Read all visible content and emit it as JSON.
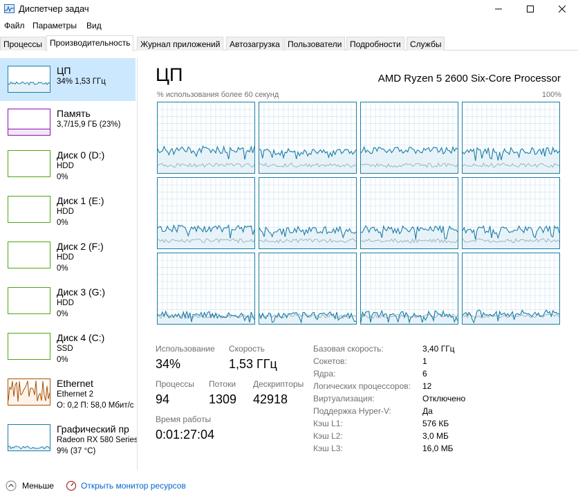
{
  "window": {
    "title": "Диспетчер задач"
  },
  "menu": [
    "Файл",
    "Параметры",
    "Вид"
  ],
  "tabs": [
    "Процессы",
    "Производительность",
    "Журнал приложений",
    "Автозагрузка",
    "Пользователи",
    "Подробности",
    "Службы"
  ],
  "active_tab": 1,
  "sidebar": [
    {
      "name": "ЦП",
      "line2": "34% 1,53 ГГц",
      "line3": "",
      "color": "#1a7ca6",
      "fill": "#e4f1f8",
      "selected": true
    },
    {
      "name": "Память",
      "line2": "3,7/15,9 ГБ (23%)",
      "line3": "",
      "color": "#8b12ae",
      "fill": "#f3e6f7",
      "selected": false
    },
    {
      "name": "Диск 0 (D:)",
      "line2": "HDD",
      "line3": "0%",
      "color": "#4da60c",
      "fill": "#eef7e6",
      "selected": false
    },
    {
      "name": "Диск 1 (E:)",
      "line2": "HDD",
      "line3": "0%",
      "color": "#4da60c",
      "fill": "#eef7e6",
      "selected": false
    },
    {
      "name": "Диск 2 (F:)",
      "line2": "HDD",
      "line3": "0%",
      "color": "#4da60c",
      "fill": "#eef7e6",
      "selected": false
    },
    {
      "name": "Диск 3 (G:)",
      "line2": "HDD",
      "line3": "0%",
      "color": "#4da60c",
      "fill": "#eef7e6",
      "selected": false
    },
    {
      "name": "Диск 4 (C:)",
      "line2": "SSD",
      "line3": "0%",
      "color": "#4da60c",
      "fill": "#eef7e6",
      "selected": false
    },
    {
      "name": "Ethernet",
      "line2": "Ethernet 2",
      "line3": "О: 0,2 П: 58,0 Мбит/с",
      "color": "#a74f01",
      "fill": "#fcf3eb",
      "selected": false
    },
    {
      "name": "Графический пр",
      "line2": "Radeon RX 580 Series",
      "line3": "9% (37 °C)",
      "color": "#1a7ca6",
      "fill": "#e4f1f8",
      "selected": false
    }
  ],
  "main": {
    "title": "ЦП",
    "cpu_model": "AMD Ryzen 5 2600 Six-Core Processor",
    "graph_label": "% использования более 60 секунд",
    "graph_max": "100%",
    "core_count": 12,
    "core_levels": [
      0.33,
      0.3,
      0.32,
      0.31,
      0.28,
      0.26,
      0.27,
      0.27,
      0.13,
      0.12,
      0.14,
      0.15
    ]
  },
  "stats": {
    "usage_label": "Использование",
    "usage_value": "34%",
    "speed_label": "Скорость",
    "speed_value": "1,53 ГГц",
    "processes_label": "Процессы",
    "processes_value": "94",
    "threads_label": "Потоки",
    "threads_value": "1309",
    "handles_label": "Дескрипторы",
    "handles_value": "42918",
    "uptime_label": "Время работы",
    "uptime_value": "0:01:27:04"
  },
  "info": [
    {
      "label": "Базовая скорость:",
      "value": "3,40 ГГц"
    },
    {
      "label": "Сокетов:",
      "value": "1"
    },
    {
      "label": "Ядра:",
      "value": "6"
    },
    {
      "label": "Логических процессоров:",
      "value": "12"
    },
    {
      "label": "Виртуализация:",
      "value": "Отключено"
    },
    {
      "label": "Поддержка Hyper-V:",
      "value": "Да"
    },
    {
      "label": "Кэш L1:",
      "value": "576 КБ"
    },
    {
      "label": "Кэш L2:",
      "value": "3,0 МБ"
    },
    {
      "label": "Кэш L3:",
      "value": "16,0 МБ"
    }
  ],
  "footer": {
    "less": "Меньше",
    "monitor": "Открыть монитор ресурсов"
  },
  "colors": {
    "cpu": "#1a7ca6",
    "cpu_fill": "#e4f1f8",
    "grid": "#cfe6f0",
    "selected": "#cce8ff",
    "link": "#0066cc"
  }
}
